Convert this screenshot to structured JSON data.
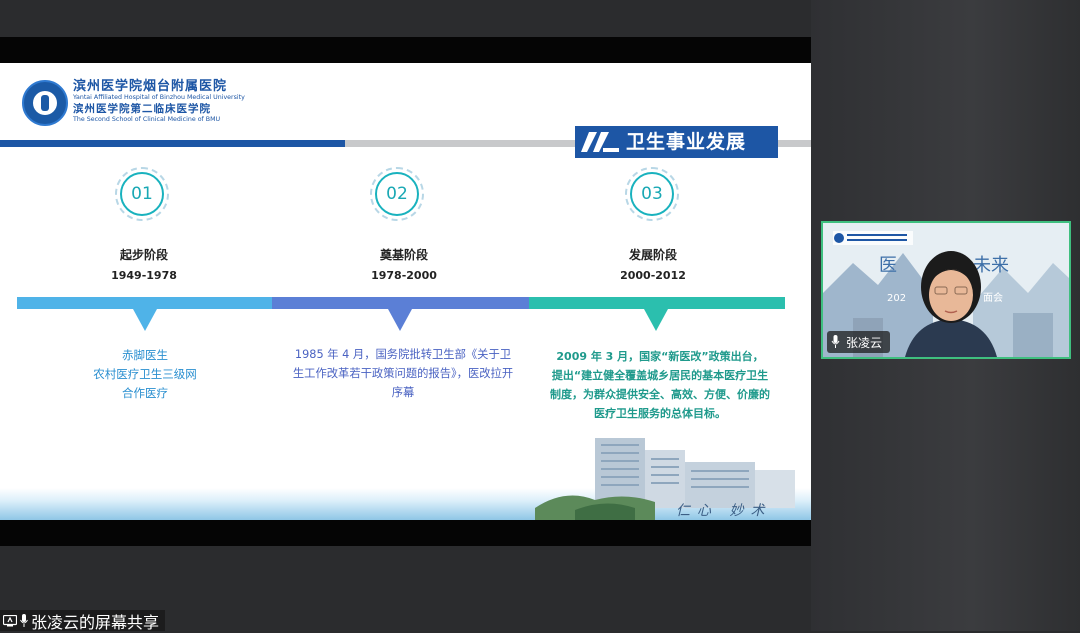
{
  "logo": {
    "cn_line1": "滨州医学院烟台附属医院",
    "en_line1": "Yantai Affiliated Hospital of Binzhou Medical University",
    "cn_line2": "滨州医学院第二临床医学院",
    "en_line2": "The Second School of Clinical Medicine of BMU"
  },
  "slide_title": "卫生事业发展",
  "stages": [
    {
      "num": "01",
      "name": "起步阶段",
      "years": "1949-1978",
      "desc": [
        "赤脚医生",
        "农村医疗卫生三级网",
        "合作医疗"
      ],
      "color": "#4fb3e8"
    },
    {
      "num": "02",
      "name": "奠基阶段",
      "years": "1978-2000",
      "desc": [
        "1985 年 4 月，国务院批转卫生部《关于卫",
        "生工作改革若干政策问题的报告》，医改拉开",
        "序幕"
      ],
      "color": "#5b7fd6"
    },
    {
      "num": "03",
      "name": "发展阶段",
      "years": "2000-2012",
      "desc": [
        "2009 年 3 月，国家“新医改”政策出台，",
        "提出“建立健全覆盖城乡居民的基本医疗卫生",
        "制度，为群众提供安全、高效、方便、价廉的",
        "医疗卫生服务的总体目标。"
      ],
      "color": "#2bbfae"
    }
  ],
  "calligraphy": "仁心 妙术",
  "share_label": "张凌云的屏幕共享",
  "participant": {
    "name": "张凌云",
    "bg_title_a": "医",
    "bg_title_b": "未来",
    "bg_sub_a": "202",
    "bg_sub_b": "面会"
  }
}
